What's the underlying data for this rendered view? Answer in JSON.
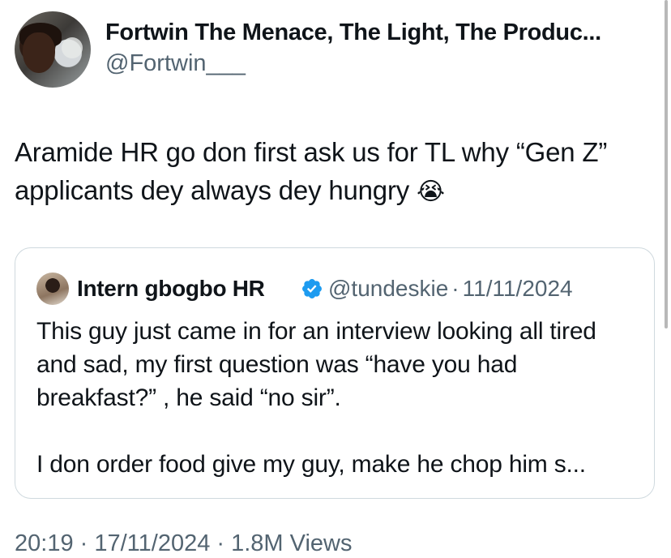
{
  "tweet": {
    "author": {
      "display_name": "Fortwin The Menace, The Light, The Produc...",
      "handle": "@Fortwin___"
    },
    "text": "Aramide HR go don first ask us for TL why “Gen Z” applicants dey always dey hungry",
    "emoji": "😭"
  },
  "quote": {
    "author": {
      "display_name": "Intern gbogbo HR",
      "handle": "@tundeskie",
      "separator": "·",
      "date": "11/11/2024",
      "verified": true
    },
    "paragraphs": [
      "This guy just came in for an interview looking all tired and sad, my first question was “have you had breakfast?” , he said “no sir”.",
      "I don order food give my guy, make he chop him s..."
    ]
  },
  "meta": {
    "timestamp": "20:19 · 17/11/2024 · 1.8M Views"
  },
  "colors": {
    "text": "#0f1419",
    "secondary": "#536471",
    "border": "#cfd9de",
    "verified": "#1d9bf0"
  }
}
